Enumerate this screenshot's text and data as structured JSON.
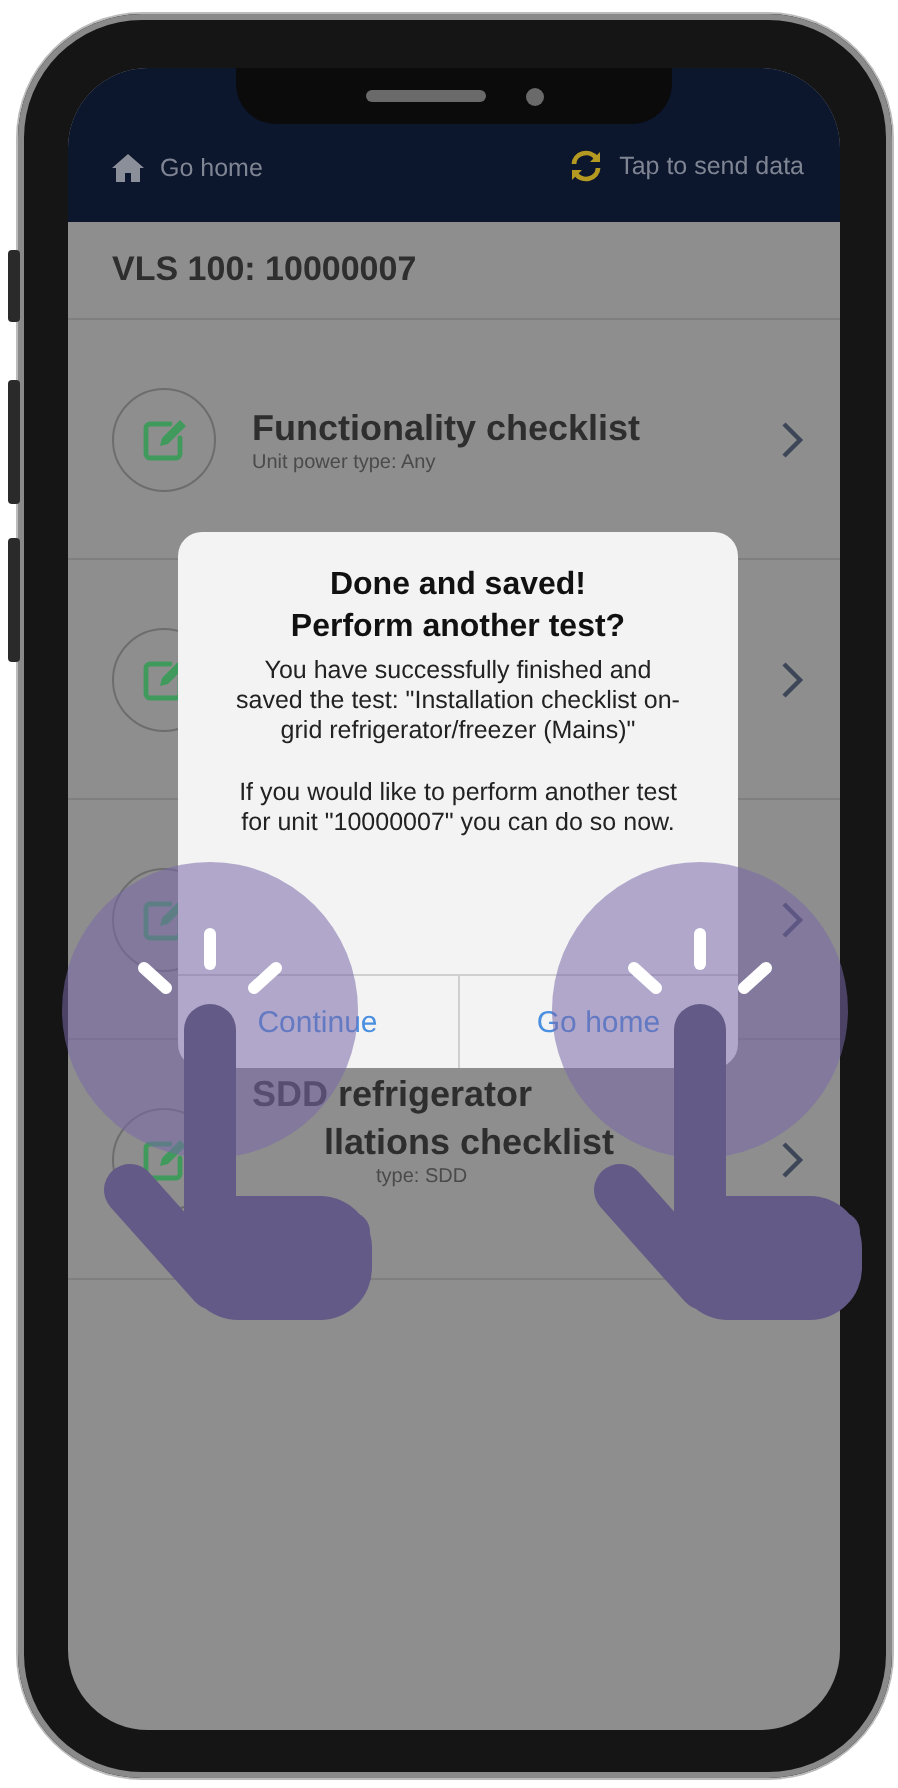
{
  "nav": {
    "home_label": "Go home",
    "send_label": "Tap to send data"
  },
  "unit_title": "VLS 100: 10000007",
  "checklists": [
    {
      "kind": "full",
      "title_lines": [
        "Functionality checklist"
      ],
      "subtitle": "Unit power type: Any"
    },
    {
      "kind": "covered"
    },
    {
      "kind": "covered"
    },
    {
      "kind": "partial",
      "title_lines": [
        "SDD refrigerator",
        "llations checklist"
      ],
      "subtitle": "type: SDD"
    }
  ],
  "dialog": {
    "title_lines": [
      "Done and saved!",
      "Perform another test?"
    ],
    "paragraphs": [
      "You have successfully finished and saved the test: \"Installation checklist on-grid refrigerator/freezer (Mains)\"",
      "If you would like to perform another test for unit \"10000007\" you can do so now."
    ],
    "buttons": [
      "Continue",
      "Go home"
    ]
  }
}
